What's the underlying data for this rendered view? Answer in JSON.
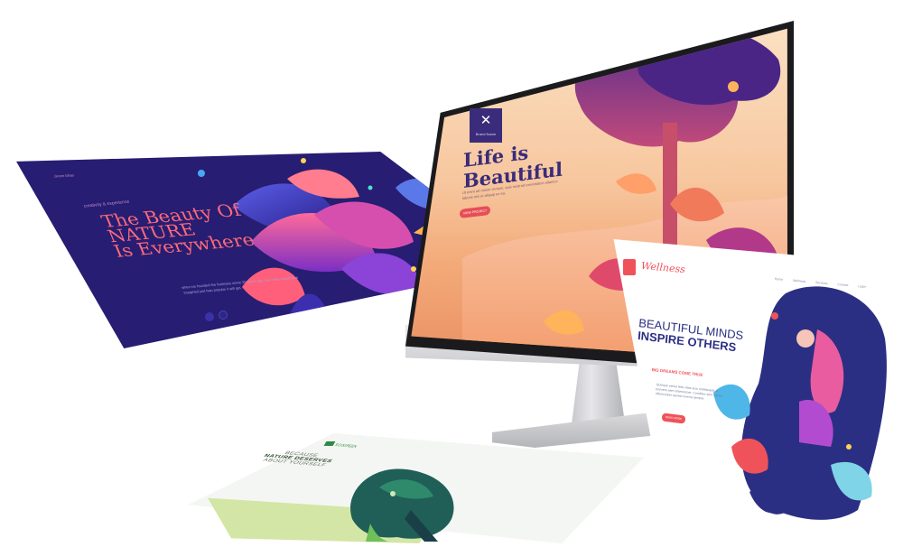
{
  "monitor": {
    "brand_name": "Brand Name",
    "hero_title_line1": "Life is",
    "hero_title_line2": "Beautiful",
    "hero_subtitle": "Ut enim ad minim veniam, quis nostrud exercitation ullamco laboris nisi ut aliquip ex ea.",
    "hero_button": "VIEW PROJECT"
  },
  "nature_page": {
    "logo_text": "Green Ideas",
    "tagline": "creativity & experience",
    "title_line1": "The Beauty Of",
    "title_line2": "NATURE",
    "title_line3": "Is Everywhere",
    "body": "when we founded the business some 20 years ago, we never could have imagined just how popular it will get."
  },
  "wellness_page": {
    "logo": "Wellness",
    "nav": [
      "Home",
      "Wellness",
      "Services",
      "Contact",
      "Login"
    ],
    "title_line1": "BEAUTIFUL MINDS",
    "title_line2": "INSPIRE OTHERS",
    "subtitle": "BIG DREAMS COME TRUE",
    "body": "Quisque varius felis vitae arcu malesuada, a posuere sem ullamcorper. Curabitur sem sapien, ullamcorper laoreet viverra semper.",
    "button": "READ MORE"
  },
  "eco_page": {
    "logo": "ECOGREEN",
    "headline_line1": "BECAUSE",
    "headline_line2": "NATURE DESERVES",
    "headline_line3": "ABOUT YOURSELF"
  },
  "colors": {
    "monitor_bezel": "#1b1b1d",
    "hero_purple": "#3a2c7a",
    "nature_bg": "#271d72",
    "nature_title": "#ff6a7c",
    "wellness_accent": "#f0525a",
    "wellness_title": "#2b2f83",
    "eco_green": "#2e8a46"
  }
}
